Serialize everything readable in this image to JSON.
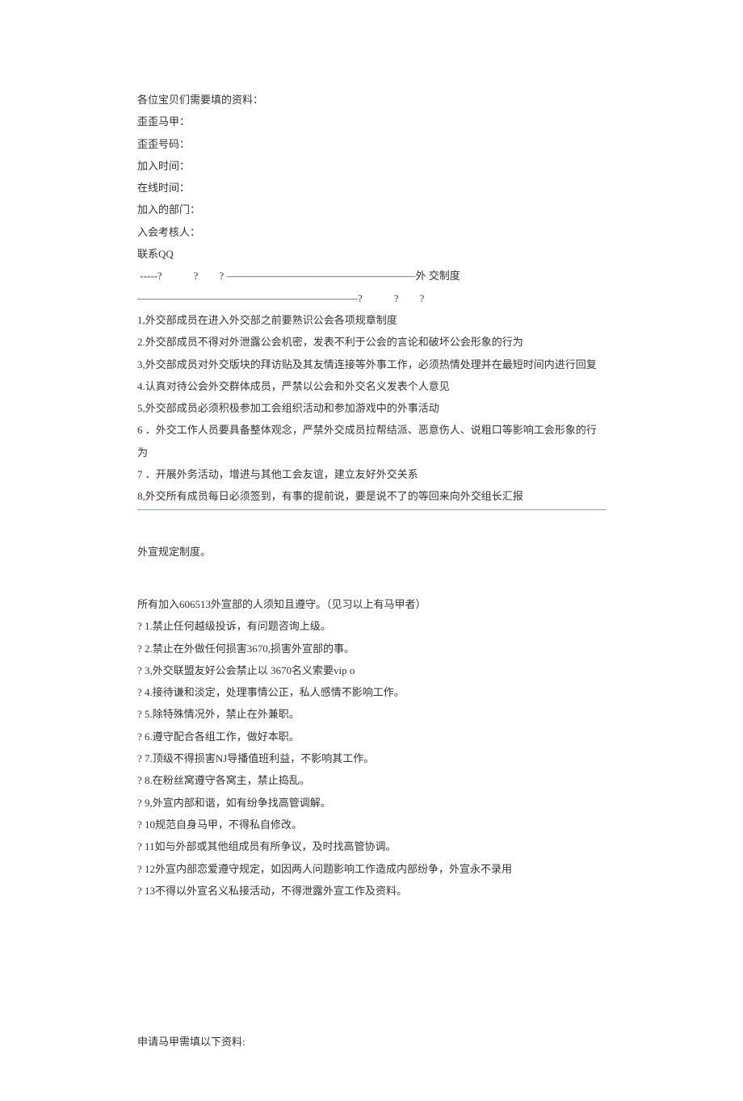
{
  "form_header": "各位宝贝们需要填的资料：",
  "form_fields": [
    "歪歪马甲：",
    "歪歪号码：",
    "加入时间：",
    "在线时间：",
    "加入的部门：",
    "入会考核人：",
    "联系QQ"
  ],
  "divider_line": " -----?　　　?　　? ——————————————————外 交制度 —————————————————————?　　　?　　?",
  "rules_section_a": [
    "1,外交部成员在进入外交部之前要熟识公会各项规章制度",
    "2.外交部成员不得对外泄露公会机密，发表不利于公会的言论和破坏公会形象的行为",
    "3,外交部成员对外交版块的拜访贴及其友情连接等外事工作，必须热情处理并在最短时间内进行回复",
    "4.认真对待公会外交群体成员，严禁以公会和外交名义发表个人意见",
    "5,外交部成员必须积极参加工会组织活动和参加游戏中的外事活动",
    "6 ．外交工作人员要具备整体观念，严禁外交成员拉帮结派、恶意伤人、说粗口等影响工会形象的行为",
    "7 ．开展外务活动，增进与其他工会友谊，建立友好外交关系",
    "8,外交所有成员每日必须签到，有事的提前说，要是说不了的等回来向外交组长汇报"
  ],
  "section_b_title": "外宣规定制度。",
  "section_b_intro": "所有加入606513外宣部的人须知且遵守。（见习以上有马甲者）",
  "rules_section_b": [
    "? 1.禁止任何越级投诉，有问题咨询上级。",
    "? 2.禁止在外做任何损害3670,损害外宣部的事。",
    "? 3,外交联盟友好公会禁止以 3670名义索要vip o",
    "? 4.接待谦和淡定，处理事情公正，私人感情不影响工作。",
    "? 5.除特殊情况外，禁止在外兼职。",
    "? 6.遵守配合各组工作，做好本职。",
    "? 7.顶级不得损害NJ导播值班利益，不影响其工作。",
    "? 8.在粉丝窝遵守各窝主，禁止捣乱。",
    "? 9,外宣内部和谐，如有纷争找高管调解。",
    "? 10规范自身马甲，不得私自修改。",
    "? 11如与外部或其他组成员有所争议，及时找高管协调。",
    "? 12外宣内部恋爱遵守规定，如因两人问题影响工作造成内部纷争，外宣永不录用",
    "? 13不得以外宣名义私接活动，不得泄露外宣工作及资料。"
  ],
  "footer_text": "申请马甲需填以下资料:"
}
